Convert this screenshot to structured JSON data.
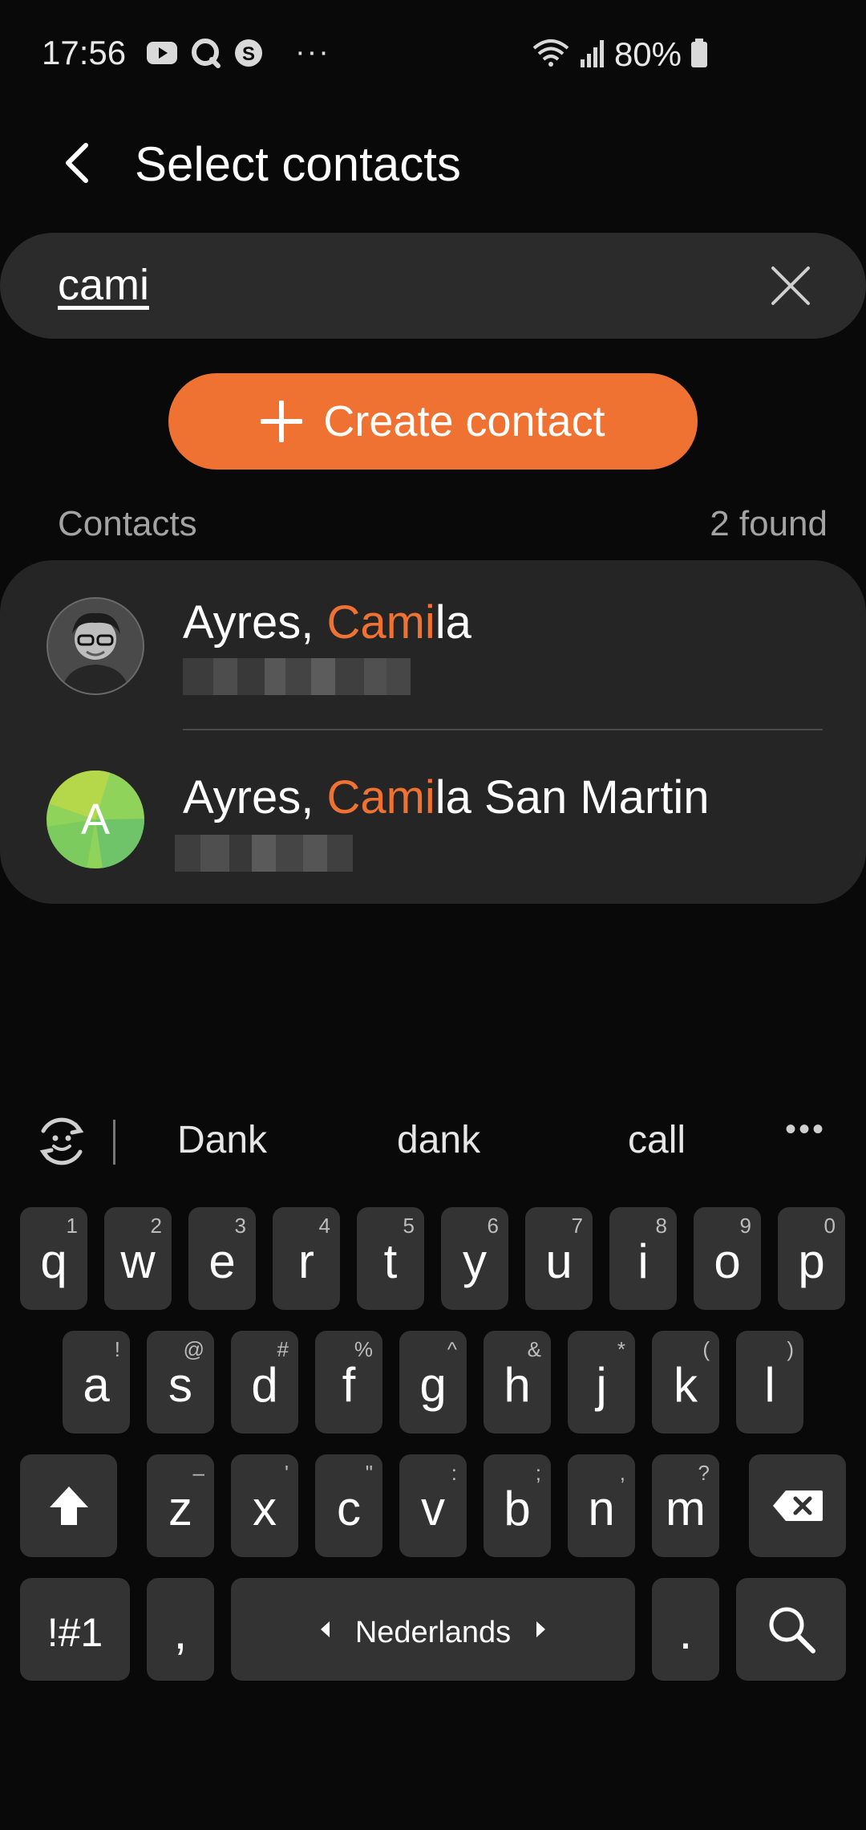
{
  "status_bar": {
    "time": "17:56",
    "left_icons": [
      "youtube-icon",
      "chat-icon",
      "skype-icon"
    ],
    "overflow": "···",
    "battery_text": "80%"
  },
  "app_bar": {
    "title": "Select contacts"
  },
  "search": {
    "value": "cami"
  },
  "create_contact": {
    "label": "Create contact"
  },
  "section": {
    "label": "Contacts",
    "count": "2 found"
  },
  "contacts": [
    {
      "name_prefix": "Ayres, ",
      "name_match": "Cami",
      "name_suffix": "la"
    },
    {
      "name_prefix": "Ayres, ",
      "name_match": "Cami",
      "name_suffix": "la San Martin",
      "avatar_letter": "A"
    }
  ],
  "keyboard": {
    "suggestions": [
      "Dank",
      "dank",
      "call"
    ],
    "more": "•••",
    "row1": [
      {
        "key": "q",
        "hint": "1"
      },
      {
        "key": "w",
        "hint": "2"
      },
      {
        "key": "e",
        "hint": "3"
      },
      {
        "key": "r",
        "hint": "4"
      },
      {
        "key": "t",
        "hint": "5"
      },
      {
        "key": "y",
        "hint": "6"
      },
      {
        "key": "u",
        "hint": "7"
      },
      {
        "key": "i",
        "hint": "8"
      },
      {
        "key": "o",
        "hint": "9"
      },
      {
        "key": "p",
        "hint": "0"
      }
    ],
    "row2": [
      {
        "key": "a",
        "hint": "!"
      },
      {
        "key": "s",
        "hint": "@"
      },
      {
        "key": "d",
        "hint": "#"
      },
      {
        "key": "f",
        "hint": "%"
      },
      {
        "key": "g",
        "hint": "^"
      },
      {
        "key": "h",
        "hint": "&"
      },
      {
        "key": "j",
        "hint": "*"
      },
      {
        "key": "k",
        "hint": "("
      },
      {
        "key": "l",
        "hint": ")"
      }
    ],
    "row3": [
      {
        "key": "z",
        "hint": "–"
      },
      {
        "key": "x",
        "hint": "'"
      },
      {
        "key": "c",
        "hint": "\""
      },
      {
        "key": "v",
        "hint": ":"
      },
      {
        "key": "b",
        "hint": ";"
      },
      {
        "key": "n",
        "hint": ","
      },
      {
        "key": "m",
        "hint": "?"
      }
    ],
    "symbols_key": "!#1",
    "comma_key": ",",
    "space_label": "Nederlands",
    "period_key": "."
  },
  "colors": {
    "accent": "#ef7232",
    "background": "#090909",
    "card": "#252525",
    "key": "#333333"
  }
}
